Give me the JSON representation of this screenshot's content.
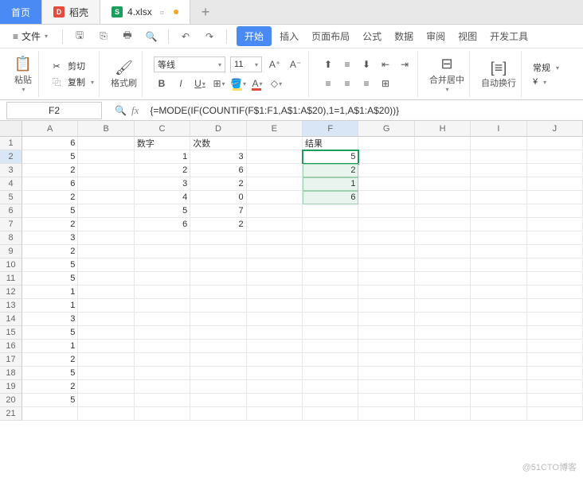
{
  "tabs": {
    "home": "首页",
    "doc_icon_bg": "#e44b3b",
    "doc_icon_txt": "D",
    "doc_label": "稻壳",
    "active_icon_bg": "#1a9e5c",
    "active_icon_txt": "S",
    "active_label": "4.xlsx",
    "new": "+"
  },
  "menubar": {
    "file": "文件",
    "items": [
      "开始",
      "插入",
      "页面布局",
      "公式",
      "数据",
      "审阅",
      "视图",
      "开发工具"
    ]
  },
  "ribbon": {
    "paste": "粘贴",
    "cut": "剪切",
    "copy": "复制",
    "format_painter": "格式刷",
    "font_name": "等线",
    "font_size": "11",
    "merge": "合并居中",
    "wrap": "自动换行",
    "general": "常规",
    "currency": "¥"
  },
  "fbar": {
    "namebox": "F2",
    "fx": "fx",
    "formula": "{=MODE(IF(COUNTIF(F$1:F1,A$1:A$20),1=1,A$1:A$20))}"
  },
  "grid": {
    "cols": [
      "A",
      "B",
      "C",
      "D",
      "E",
      "F",
      "G",
      "H",
      "I",
      "J"
    ],
    "selected_cell": "F2",
    "selected_col": "F",
    "selected_row": 2,
    "row_count": 21,
    "headers": {
      "C": "数字",
      "D": "次数",
      "F": "结果"
    },
    "data": {
      "A": [
        6,
        5,
        2,
        6,
        2,
        5,
        2,
        3,
        2,
        5,
        5,
        1,
        1,
        3,
        5,
        1,
        2,
        5,
        2,
        5
      ],
      "C": [
        null,
        1,
        2,
        3,
        4,
        5,
        6
      ],
      "D": [
        null,
        3,
        6,
        2,
        0,
        7,
        2
      ],
      "F": [
        null,
        5,
        2,
        1,
        6
      ]
    },
    "shaded_f_rows": [
      3,
      4,
      5
    ]
  },
  "watermark": "@51CTO博客"
}
